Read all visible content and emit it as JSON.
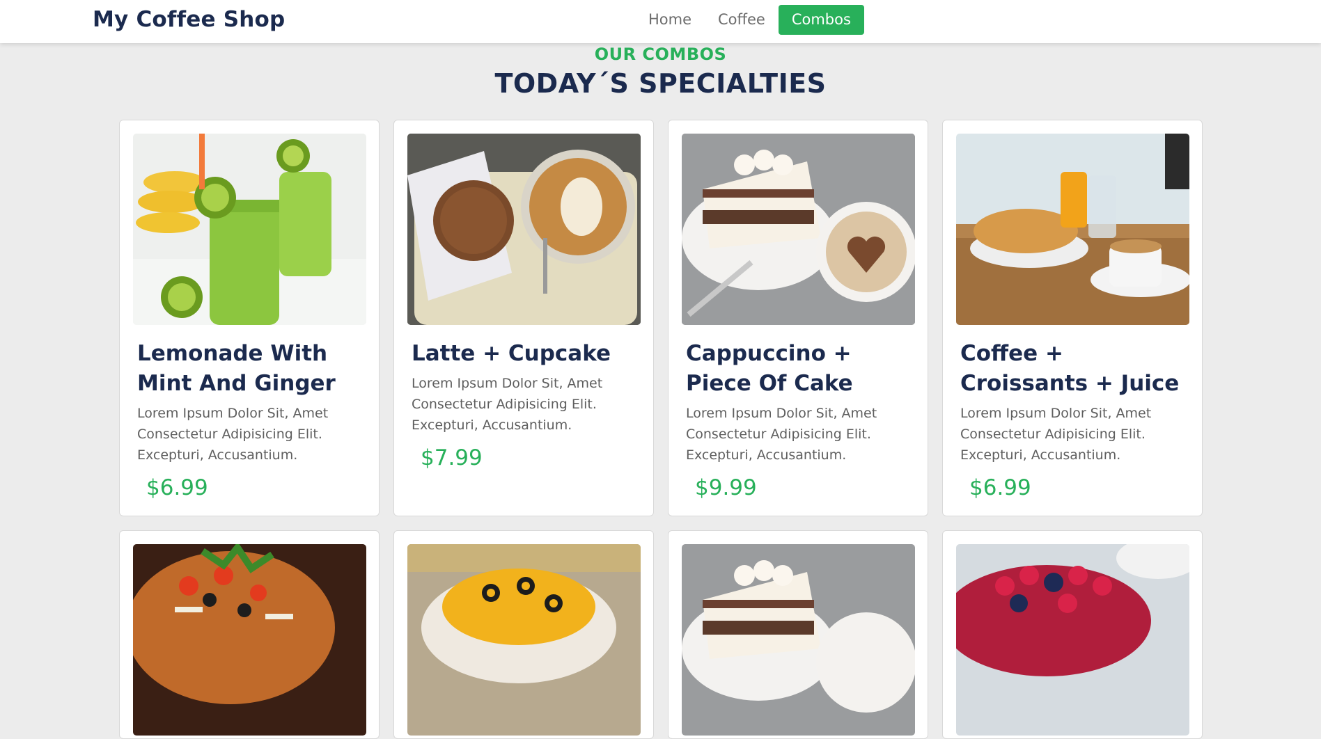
{
  "navbar": {
    "brand": "My Coffee Shop",
    "links": [
      {
        "label": "Home"
      },
      {
        "label": "Coffee"
      },
      {
        "label": "Combos",
        "active": true
      }
    ]
  },
  "section": {
    "eyebrow": "OUR COMBOS",
    "title": "TODAY´S SPECIALTIES"
  },
  "cards": [
    {
      "title": "Lemonade With Mint And Ginger",
      "description": "Lorem Ipsum Dolor Sit, Amet Consectetur Adipisicing Elit. Excepturi, Accusantium.",
      "price": "$6.99",
      "image": "green smoothie with kiwi and bananas"
    },
    {
      "title": "Latte + Cupcake",
      "description": "Lorem Ipsum Dolor Sit, Amet Consectetur Adipisicing Elit. Excepturi, Accusantium.",
      "price": "$7.99",
      "image": "latte art with muffin on tray"
    },
    {
      "title": "Cappuccino + Piece Of Cake",
      "description": "Lorem Ipsum Dolor Sit, Amet Consectetur Adipisicing Elit. Excepturi, Accusantium.",
      "price": "$9.99",
      "image": "tiramisu cake with cappuccino heart"
    },
    {
      "title": "Coffee + Croissants + Juice",
      "description": "Lorem Ipsum Dolor Sit, Amet Consectetur Adipisicing Elit. Excepturi, Accusantium.",
      "price": "$6.99",
      "image": "croissants with coffee and orange juice"
    }
  ],
  "second_row_images": [
    "taco salad with vegetables",
    "nachos with olives and cheese",
    "tiramisu cake with cappuccino",
    "berry tart with coffee"
  ],
  "colors": {
    "accent": "#28b05a",
    "heading": "#1b2a4e",
    "background": "#ececec"
  }
}
